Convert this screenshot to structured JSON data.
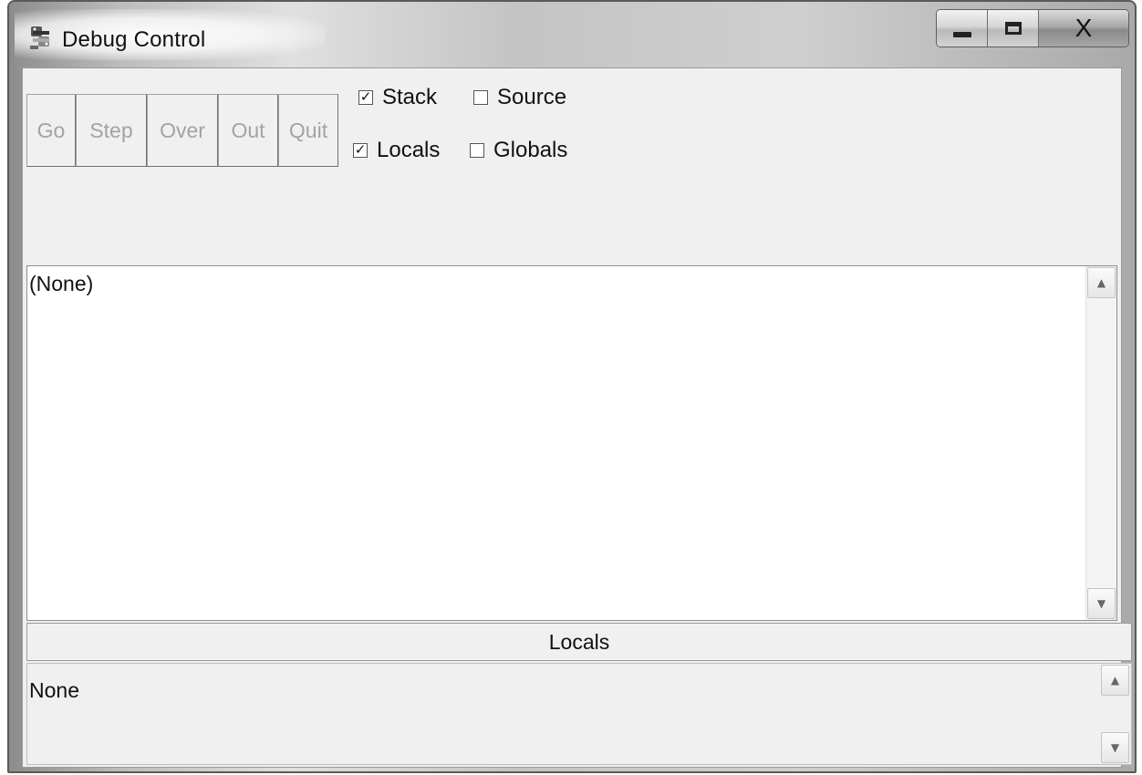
{
  "window": {
    "title": "Debug Control",
    "close_label": "X"
  },
  "toolbar": {
    "buttons": [
      "Go",
      "Step",
      "Over",
      "Out",
      "Quit"
    ]
  },
  "options": {
    "stack": {
      "label": "Stack",
      "checked": true
    },
    "source": {
      "label": "Source",
      "checked": false
    },
    "locals": {
      "label": "Locals",
      "checked": true
    },
    "globals": {
      "label": "Globals",
      "checked": false
    }
  },
  "stack_pane": {
    "text": "(None)"
  },
  "locals_section": {
    "header": "Locals",
    "text": "None"
  },
  "icons": {
    "app": "python-debug-icon",
    "minimize": "minimize-icon",
    "maximize": "maximize-icon",
    "scroll_up": "scroll-up-arrow-icon",
    "scroll_down": "scroll-down-arrow-icon"
  }
}
